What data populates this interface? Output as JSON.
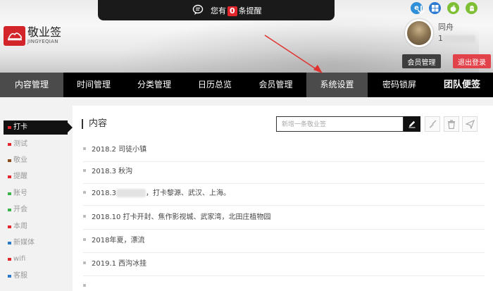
{
  "notice": {
    "prefix": "您有",
    "count": "0",
    "suffix": "条提醒"
  },
  "logo": {
    "title": "敬业签",
    "subtitle": "JINGYEQIAN"
  },
  "browsers": [
    {
      "name": "ie-icon",
      "color": "#2f8fd8"
    },
    {
      "name": "windows-icon",
      "color": "#2b79d0"
    },
    {
      "name": "apple-icon",
      "color": "#7fbf36"
    },
    {
      "name": "android-icon",
      "color": "#7fbf36"
    }
  ],
  "user": {
    "name": "同舟",
    "phone_prefix": "1",
    "member_btn": "会员管理",
    "logout_btn": "退出登录"
  },
  "nav": [
    {
      "label": "内容管理",
      "active": true
    },
    {
      "label": "时间管理"
    },
    {
      "label": "分类管理"
    },
    {
      "label": "日历总览"
    },
    {
      "label": "会员管理"
    },
    {
      "label": "系统设置",
      "active": true
    },
    {
      "label": "密码锁屏"
    },
    {
      "label": "团队便签",
      "strong": true
    }
  ],
  "sidebar": [
    {
      "label": "打卡",
      "color": "#e3262c",
      "active": true
    },
    {
      "label": "测试",
      "color": "#e3262c"
    },
    {
      "label": "敬业",
      "color": "#8a4b1d"
    },
    {
      "label": "提醒",
      "color": "#e3262c"
    },
    {
      "label": "账号",
      "color": "#3cb34a"
    },
    {
      "label": "开会",
      "color": "#3cb34a"
    },
    {
      "label": "本周",
      "color": "#e3262c"
    },
    {
      "label": "新媒体",
      "color": "#2a78c8"
    },
    {
      "label": "wifi",
      "color": "#e3262c"
    },
    {
      "label": "客服",
      "color": "#2a78c8"
    },
    {
      "label": "",
      "color": "#3cb34a"
    }
  ],
  "main": {
    "title": "内容",
    "search_placeholder": "新增一条敬业签",
    "items": [
      {
        "a": "2018.2 司徒小镇"
      },
      {
        "a": "2018.3 秋沟"
      },
      {
        "a": "2018.3",
        "b": "，打卡黎源、武汉、上海。",
        "blurred": true
      },
      {
        "a": "2018.10 打卡开封、焦作影视城、武家湾，北田庄植物园"
      },
      {
        "a": "2018年夏，漂流"
      },
      {
        "a": "2019.1 西沟冰挂"
      },
      {
        "a": ""
      }
    ]
  }
}
